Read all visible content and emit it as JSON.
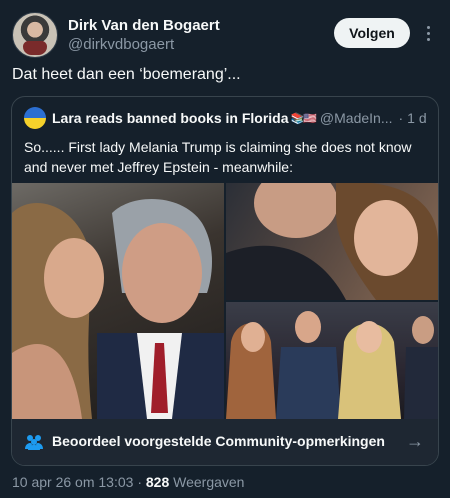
{
  "author": {
    "display_name": "Dirk Van den Bogaert",
    "handle": "@dirkvdbogaert",
    "follow_label": "Volgen"
  },
  "tweet": {
    "text": "Dat heet dan een ‘boemerang’..."
  },
  "quoted": {
    "display_name": "Lara reads banned books in Florida",
    "name_emoji": "📚🇺🇸",
    "handle": "@MadeIn...",
    "separator": "·",
    "time": "1 d",
    "text": "So...... First lady Melania Trump is claiming she does not know and never met Jeffrey Epstein - meanwhile:"
  },
  "community_notes": {
    "label": "Beoordeel voorgestelde Community-opmerkingen",
    "arrow": "→"
  },
  "meta": {
    "timestamp": "10 apr 26 om 13:03",
    "separator": "·",
    "views_count": "828",
    "views_label": "Weergaven"
  },
  "colors": {
    "background": "#15202b",
    "border": "#38444d",
    "secondary_text": "#8b98a5",
    "community_accent": "#1d9bf0"
  }
}
